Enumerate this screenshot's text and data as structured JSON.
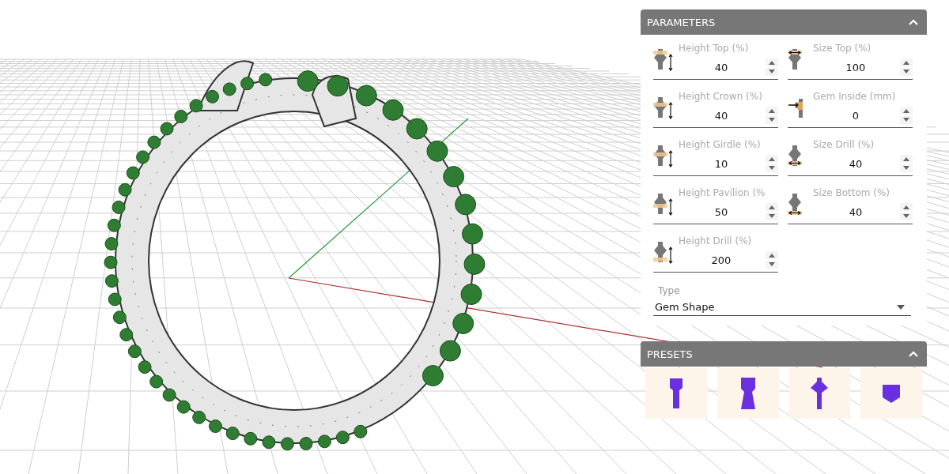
{
  "parameters": {
    "title": "PARAMETERS",
    "expanded": true,
    "fields": [
      {
        "kind": "top",
        "label": "Height Top (%)",
        "value": "40"
      },
      {
        "kind": "sizetop",
        "label": "Size Top (%)",
        "value": "100"
      },
      {
        "kind": "crown",
        "label": "Height Crown (%)",
        "value": "40"
      },
      {
        "kind": "inside",
        "label": "Gem Inside (mm)",
        "value": "0"
      },
      {
        "kind": "girdle",
        "label": "Height Girdle (%)",
        "value": "10"
      },
      {
        "kind": "sizedrill",
        "label": "Size Drill (%)",
        "value": "40"
      },
      {
        "kind": "pavilion",
        "label": "Height Pavilion (%",
        "value": "50"
      },
      {
        "kind": "sizebottom",
        "label": "Size Bottom (%)",
        "value": "40"
      },
      {
        "kind": "drill",
        "label": "Height Drill (%)",
        "value": "200"
      }
    ],
    "type": {
      "label": "Type",
      "value": "Gem Shape"
    }
  },
  "presets": {
    "title": "PRESETS",
    "expanded": true,
    "items": [
      {
        "kind": "stem"
      },
      {
        "kind": "flare"
      },
      {
        "kind": "spindle"
      },
      {
        "kind": "bowl"
      }
    ]
  }
}
